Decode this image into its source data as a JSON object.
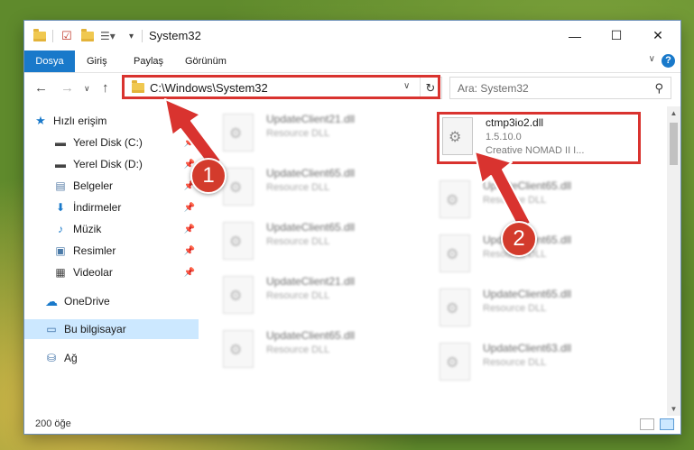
{
  "window": {
    "title": "System32",
    "controls": {
      "minimize": "—",
      "maximize": "☐",
      "close": "✕"
    }
  },
  "ribbon": {
    "tabs": [
      "Dosya",
      "Giriş",
      "Paylaş",
      "Görünüm"
    ],
    "help": "?"
  },
  "navigation": {
    "address": "C:\\Windows\\System32",
    "search_placeholder": "Ara: System32"
  },
  "sidebar": {
    "quick_access": "Hızlı erişim",
    "items": [
      {
        "label": "Yerel Disk (C:)",
        "icon": "drive-icon",
        "pinned": true
      },
      {
        "label": "Yerel Disk (D:)",
        "icon": "drive-icon",
        "pinned": true
      },
      {
        "label": "Belgeler",
        "icon": "documents-icon",
        "pinned": true
      },
      {
        "label": "İndirmeler",
        "icon": "download-icon",
        "pinned": true
      },
      {
        "label": "Müzik",
        "icon": "music-icon",
        "pinned": true
      },
      {
        "label": "Resimler",
        "icon": "pictures-icon",
        "pinned": true
      },
      {
        "label": "Videolar",
        "icon": "videos-icon",
        "pinned": true
      }
    ],
    "onedrive": "OneDrive",
    "this_pc": "Bu bilgisayar",
    "network": "Ağ"
  },
  "files": {
    "highlighted": {
      "name": "ctmp3io2.dll",
      "version": "1.5.10.0",
      "company": "Creative NOMAD II I..."
    },
    "left_column": [
      {
        "name": "UpdateClient21.dll",
        "type": "Resource DLL"
      },
      {
        "name": "UpdateClient65.dll",
        "type": "Resource DLL"
      },
      {
        "name": "UpdateClient65.dll",
        "type": "Resource DLL"
      },
      {
        "name": "UpdateClient21.dll",
        "type": "Resource DLL"
      },
      {
        "name": "UpdateClient65.dll",
        "type": "Resource DLL"
      }
    ],
    "right_column": [
      {
        "name": "UpdateClient65.dll",
        "type": "Resource DLL"
      },
      {
        "name": "UpdateClient65.dll",
        "type": "Resource DLL"
      },
      {
        "name": "UpdateClient65.dll",
        "type": "Resource DLL"
      },
      {
        "name": "UpdateClient63.dll",
        "type": "Resource DLL"
      }
    ]
  },
  "status": {
    "item_count": "200 öğe"
  },
  "annotations": {
    "badge1": "1",
    "badge2": "2",
    "color": "#d9332f"
  }
}
